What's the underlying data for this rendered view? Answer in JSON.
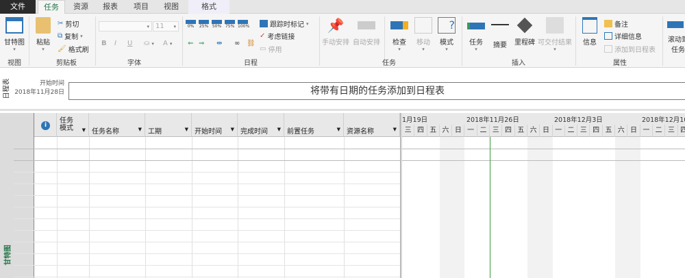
{
  "tabs": [
    {
      "label": "文件"
    },
    {
      "label": "任务"
    },
    {
      "label": "资源"
    },
    {
      "label": "报表"
    },
    {
      "label": "项目"
    },
    {
      "label": "视图"
    },
    {
      "label": "格式"
    }
  ],
  "ribbon": {
    "view": {
      "gantt": "甘特图",
      "group": "视图"
    },
    "clipboard": {
      "paste": "粘贴",
      "cut": "剪切",
      "copy": "复制",
      "painter": "格式刷",
      "group": "剪贴板"
    },
    "font": {
      "font_name": "",
      "font_size": "11",
      "bold": "B",
      "italic": "I",
      "underline": "U",
      "font_color": "A",
      "group": "字体"
    },
    "schedule": {
      "pct": [
        "0%",
        "25%",
        "50%",
        "75%",
        "100%"
      ],
      "track": "跟踪时标记",
      "respect_links": "考虑链接",
      "inactivate": "停用",
      "group": "日程"
    },
    "tasks": {
      "manual": "手动安排",
      "auto": "自动安排",
      "inspect": "检查",
      "move": "移动",
      "mode": "模式",
      "group": "任务"
    },
    "insert": {
      "task": "任务",
      "summary": "摘要",
      "milestone": "里程碑",
      "deliverable": "可交付结果",
      "group": "插入"
    },
    "properties": {
      "info": "信息",
      "notes": "备注",
      "details": "详细信息",
      "add_timeline": "添加到日程表",
      "group": "属性"
    },
    "scroll": {
      "label1": "滚动到",
      "label2": "任务"
    }
  },
  "timeline": {
    "side_label": "日程表",
    "start_label": "开始时间",
    "start_date": "2018年11月28日",
    "placeholder": "将带有日期的任务添加到日程表"
  },
  "gantt": {
    "side_label": "甘特图",
    "columns": [
      {
        "label": "任务\n模式"
      },
      {
        "label": "任务名称"
      },
      {
        "label": "工期"
      },
      {
        "label": "开始时间"
      },
      {
        "label": "完成时间"
      },
      {
        "label": "前置任务"
      },
      {
        "label": "资源名称"
      }
    ],
    "weeks": [
      "1月19日",
      "2018年11月26日",
      "2018年12月3日",
      "2018年12月10"
    ],
    "days": [
      "三",
      "四",
      "五",
      "六",
      "日",
      "一",
      "二",
      "三",
      "四",
      "五",
      "六",
      "日",
      "一",
      "二",
      "三",
      "四",
      "五",
      "六",
      "日",
      "一",
      "二",
      "三",
      "四"
    ]
  },
  "colors": {
    "accent": "#217346",
    "today_line": "#3a9a3a"
  }
}
